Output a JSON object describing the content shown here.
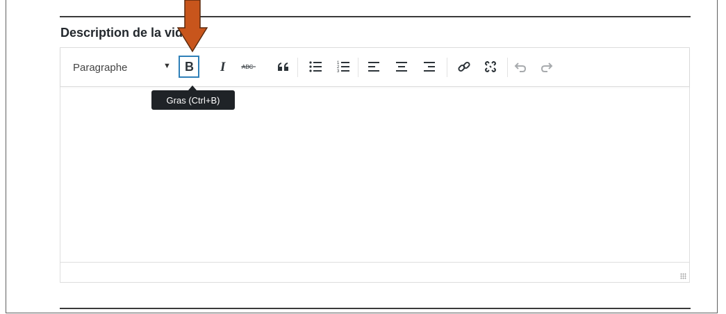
{
  "section": {
    "label": "Description de la vidéo"
  },
  "toolbar": {
    "format_select": {
      "value": "Paragraphe"
    },
    "strikethrough_glyph": "ABC"
  },
  "tooltip": {
    "text": "Gras (Ctrl+B)"
  },
  "colors": {
    "active_border": "#2e7fb8",
    "callout_arrow": "#c8551c",
    "tooltip_bg": "#1f2327"
  },
  "icons": [
    "bold-icon",
    "italic-icon",
    "strikethrough-icon",
    "blockquote-icon",
    "bullet-list-icon",
    "numbered-list-icon",
    "align-left-icon",
    "align-center-icon",
    "align-right-icon",
    "link-icon",
    "unlink-icon",
    "undo-icon",
    "redo-icon"
  ]
}
